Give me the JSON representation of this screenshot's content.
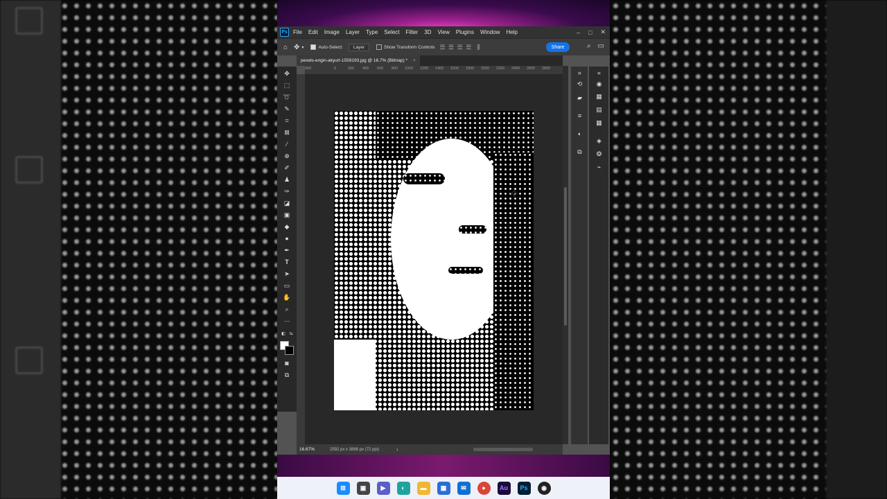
{
  "menubar": {
    "logo": "Ps",
    "items": [
      "File",
      "Edit",
      "Image",
      "Layer",
      "Type",
      "Select",
      "Filter",
      "3D",
      "View",
      "Plugins",
      "Window",
      "Help"
    ],
    "window_controls": [
      "–",
      "□",
      "✕"
    ]
  },
  "options_bar": {
    "auto_select_label": "Auto-Select:",
    "auto_select_checked": true,
    "layer_select_value": "Layer",
    "show_transform_label": "Show Transform Controls",
    "show_transform_checked": false,
    "share_label": "Share"
  },
  "document_tab": {
    "title": "pexels-engin-akyurt-1559193.jpg @ 16.7% (Bitmap) *",
    "close": "×"
  },
  "ruler": {
    "ticks": [
      "400",
      "0",
      "200",
      "400",
      "600",
      "800",
      "1000",
      "1200",
      "1400",
      "1600",
      "1800",
      "2000",
      "2200",
      "2400",
      "2600",
      "2800"
    ]
  },
  "status_bar": {
    "zoom": "16.67%",
    "doc_info": "2592 px x 3888 px (72 ppi)",
    "arrow": "›"
  },
  "colors": {
    "accent": "#1473e6",
    "ps_blue": "#31a8ff",
    "panel_bg": "#535353",
    "menubar_bg": "#323232"
  },
  "taskbar": {
    "icons": [
      "windows-start",
      "task-view",
      "teams",
      "edge",
      "file-explorer",
      "microsoft-store",
      "mail",
      "chrome",
      "audition",
      "photoshop",
      "obs"
    ]
  }
}
